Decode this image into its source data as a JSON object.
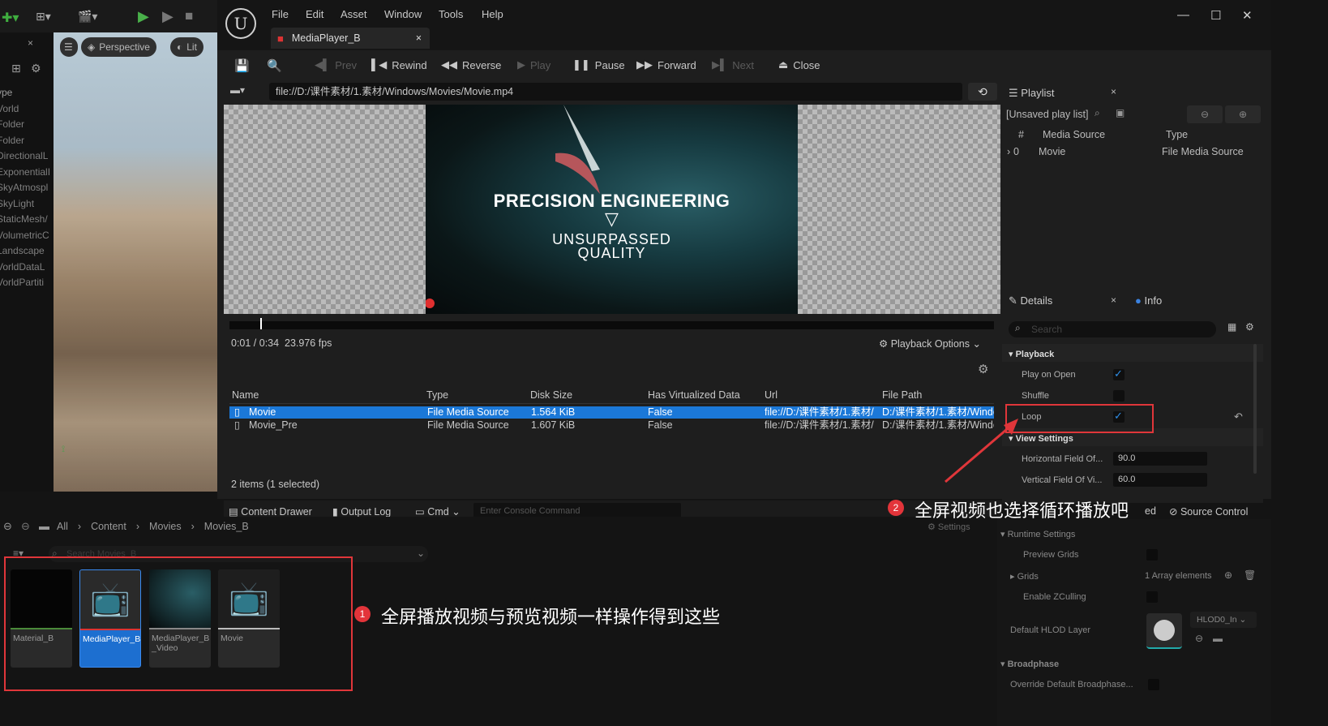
{
  "left_editor": {
    "outliner_header": "ype",
    "outliner_rows": [
      "Vorld",
      "Folder",
      "Folder",
      "DirectionalL",
      "ExponentialI",
      "SkyAtmospl",
      "SkyLight",
      "StaticMesh/",
      "VolumetricC",
      "Landscape",
      "VorldDataL",
      "VorldPartiti"
    ],
    "viewport_perspective": "Perspective",
    "viewport_lit": "Lit"
  },
  "menu": {
    "items": [
      "File",
      "Edit",
      "Asset",
      "Window",
      "Tools",
      "Help"
    ]
  },
  "tab": {
    "title": "MediaPlayer_B",
    "close": "×"
  },
  "toolbar": {
    "prev": "Prev",
    "rewind": "Rewind",
    "reverse": "Reverse",
    "play": "Play",
    "pause": "Pause",
    "forward": "Forward",
    "next": "Next",
    "close": "Close"
  },
  "url": "file://D:/课件素材/1.素材/Windows/Movies/Movie.mp4",
  "video": {
    "title": "PRECISION ENGINEERING",
    "symbol": "▽",
    "line1": "UNSURPASSED",
    "line2": "QUALITY"
  },
  "playback": {
    "time": "0:01 / 0:34",
    "fps": "23.976 fps",
    "options": "Playback Options",
    "progress_fraction": 0.04
  },
  "media_table": {
    "headers": [
      "Name",
      "Type",
      "Disk Size",
      "Has Virtualized Data",
      "Url",
      "File Path"
    ],
    "rows": [
      {
        "name": "Movie",
        "type": "File Media Source",
        "size": "1.564 KiB",
        "virt": "False",
        "url": "file://D:/课件素材/1.素材/",
        "path": "D:/课件素材/1.素材/Windo",
        "selected": true
      },
      {
        "name": "Movie_Pre",
        "type": "File Media Source",
        "size": "1.607 KiB",
        "virt": "False",
        "url": "file://D:/课件素材/1.素材/",
        "path": "D:/课件素材/1.素材/Windo",
        "selected": false
      }
    ],
    "status": "2 items (1 selected)"
  },
  "bottom_bar": {
    "content_drawer": "Content Drawer",
    "output_log": "Output Log",
    "cmd": "Cmd",
    "console_placeholder": "Enter Console Command",
    "source_control": "Source Control",
    "ed_fragment": "ed"
  },
  "playlist": {
    "title": "Playlist",
    "unsaved": "[Unsaved play list]",
    "headers": [
      "#",
      "Media Source",
      "Type"
    ],
    "rows": [
      {
        "index": "0",
        "source": "Movie",
        "type": "File Media Source"
      }
    ]
  },
  "details": {
    "title": "Details",
    "info": "Info",
    "search_placeholder": "Search",
    "playback_section": "Playback",
    "play_on_open": "Play on Open",
    "shuffle": "Shuffle",
    "loop": "Loop",
    "view_settings": "View Settings",
    "hfov_label": "Horizontal Field Of...",
    "hfov_value": "90.0",
    "vfov_label": "Vertical Field Of Vi...",
    "vfov_value": "60.0",
    "play_on_open_checked": true,
    "shuffle_checked": false,
    "loop_checked": true
  },
  "drawer": {
    "breadcrumb": [
      "All",
      "Content",
      "Movies",
      "Movies_B"
    ],
    "search_placeholder": "Search Movies_B",
    "assets": [
      {
        "label": "Material_B"
      },
      {
        "label": "MediaPlayer_B"
      },
      {
        "label": "MediaPlayer_B _Video"
      },
      {
        "label": "Movie"
      }
    ]
  },
  "world_settings": {
    "settings": "Settings",
    "runtime_settings": "Runtime Settings",
    "preview_grids": "Preview Grids",
    "grids": "Grids",
    "array_elements": "1 Array elements",
    "enable_zculling": "Enable ZCulling",
    "default_hlod_layer": "Default HLOD Layer",
    "hlod_value": "HLOD0_In",
    "broadphase": "Broadphase",
    "override_broadphase": "Override Default Broadphase..."
  },
  "annotations": {
    "note1_badge": "1",
    "note1_text": "全屏播放视频与预览视频一样操作得到这些",
    "note2_badge": "2",
    "note2_text": "全屏视频也选择循环播放吧",
    "accent": "#e0363a"
  }
}
